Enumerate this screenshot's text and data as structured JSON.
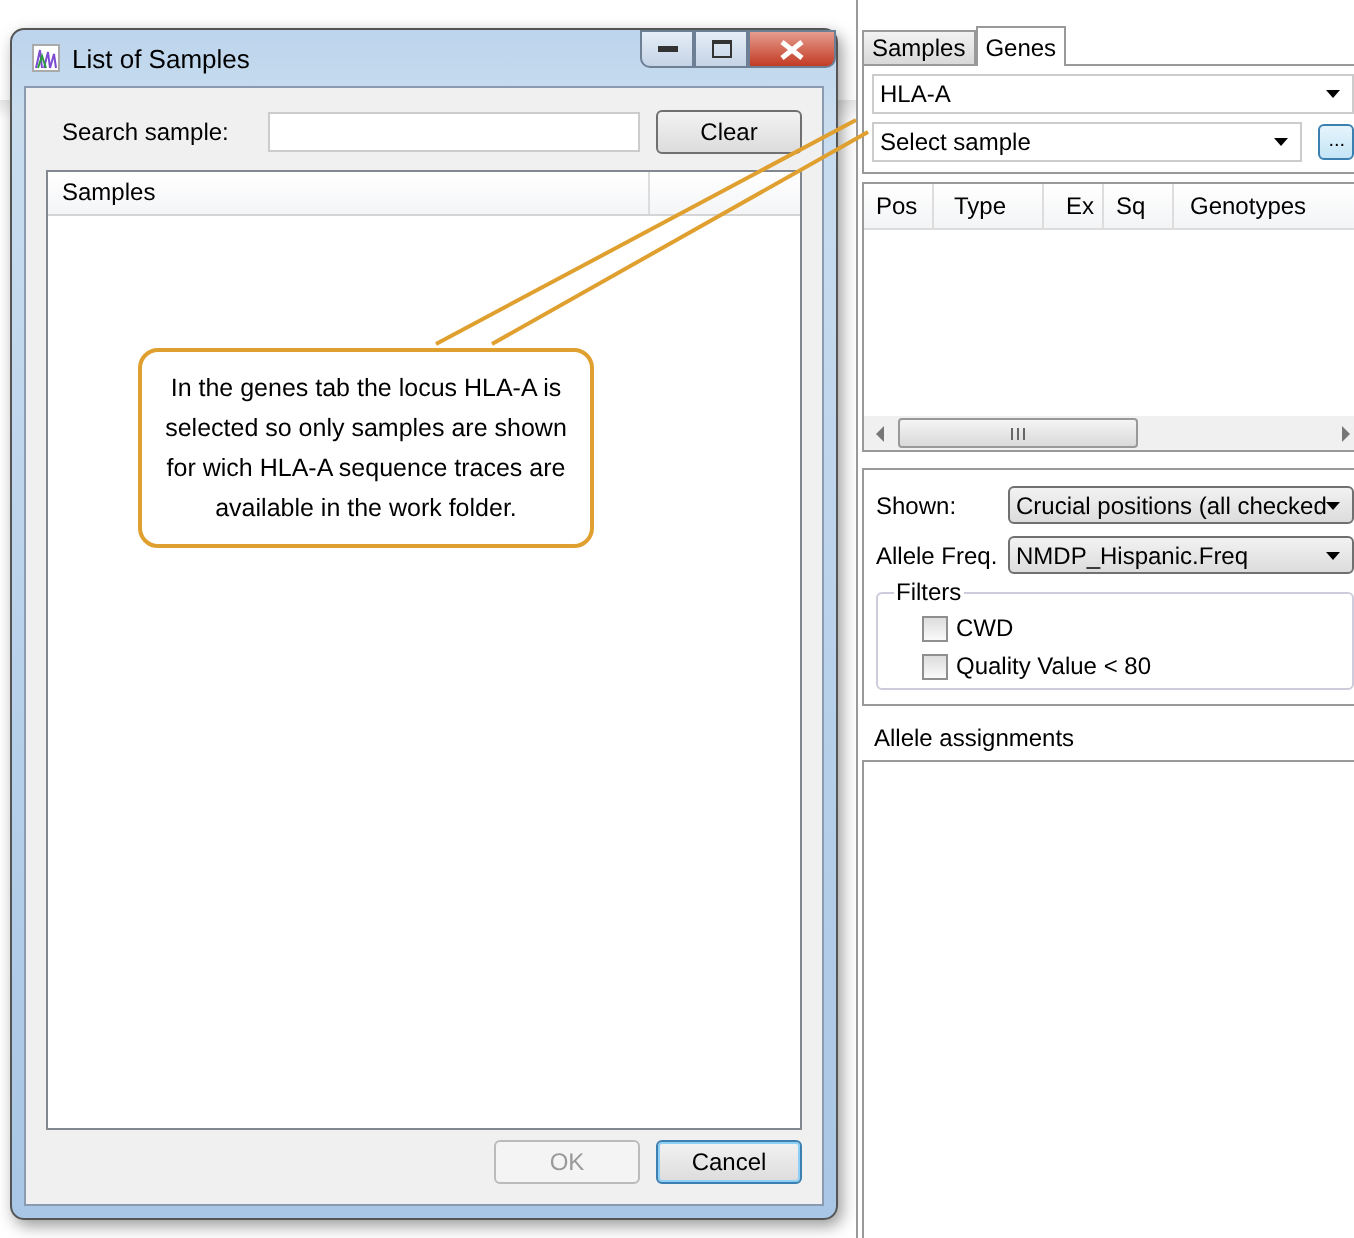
{
  "dialog": {
    "title": "List of Samples",
    "search": {
      "label": "Search sample:"
    },
    "clear_button": "Clear",
    "list": {
      "columns": [
        "Samples"
      ]
    },
    "buttons": [
      {
        "label": "OK",
        "disabled": true
      },
      {
        "label": "Cancel",
        "disabled": false
      }
    ]
  },
  "callout": {
    "text": "In the genes tab the locus HLA-A is selected so only samples are shown for wich HLA-A sequence traces are available in the work folder."
  },
  "panel": {
    "tabs": [
      {
        "label": "Samples",
        "selected": false
      },
      {
        "label": "Genes",
        "selected": true
      }
    ],
    "locus": "HLA-A",
    "sample": {
      "placeholder": "Select sample"
    },
    "browse_button": "...",
    "table": {
      "columns": [
        "Pos",
        "Type",
        "Ex",
        "Sq",
        "Genotypes"
      ]
    },
    "shown": {
      "label": "Shown:",
      "value": "Crucial positions (all checked"
    },
    "allele_freq": {
      "label": "Allele Freq.",
      "value": "NMDP_Hispanic.Freq"
    },
    "filters": {
      "title": "Filters",
      "items": [
        {
          "label": "CWD",
          "checked": false
        },
        {
          "label": "Quality Value < 80",
          "checked": false
        }
      ]
    },
    "assignments": {
      "title": "Allele assignments"
    }
  }
}
